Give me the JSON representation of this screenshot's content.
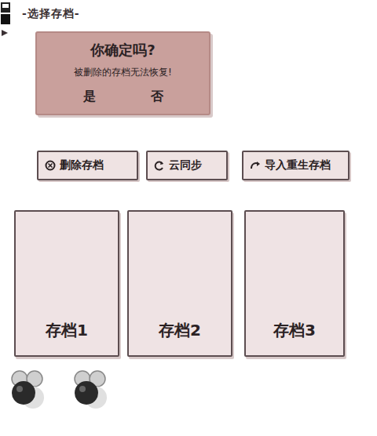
{
  "header": {
    "title": "-选择存档-"
  },
  "dialog": {
    "title": "你确定吗?",
    "message": "被删除的存档无法恢复!",
    "buttons": [
      "是",
      "否"
    ]
  },
  "actions": [
    {
      "label": "删除存档",
      "kind": "delete"
    },
    {
      "label": "云同步",
      "kind": "sync"
    },
    {
      "label": "导入重生存档",
      "kind": "import"
    }
  ],
  "slots": [
    {
      "label": "存档1"
    },
    {
      "label": "存档2"
    },
    {
      "label": "存档3"
    }
  ]
}
